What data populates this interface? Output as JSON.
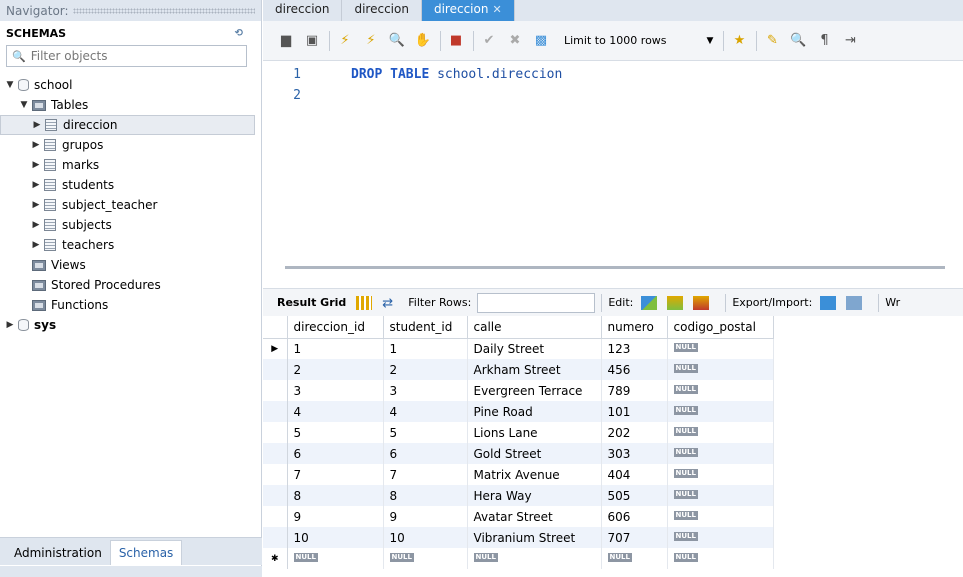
{
  "navigator": {
    "title": "Navigator:",
    "schemas_label": "SCHEMAS",
    "filter_placeholder": "Filter objects",
    "tree": {
      "school": "school",
      "tables": "Tables",
      "table_items": [
        "direccion",
        "grupos",
        "marks",
        "students",
        "subject_teacher",
        "subjects",
        "teachers"
      ],
      "views": "Views",
      "procedures": "Stored Procedures",
      "functions": "Functions",
      "sys": "sys"
    },
    "tabs": {
      "administration": "Administration",
      "schemas": "Schemas"
    }
  },
  "editor": {
    "tabs": [
      "direccion",
      "direccion",
      "direccion"
    ],
    "limit_label": "Limit to 1000 rows",
    "lines": [
      {
        "num": "1",
        "keyword": "DROP TABLE",
        "text": " school.direccion"
      },
      {
        "num": "2",
        "keyword": "",
        "text": ""
      }
    ]
  },
  "result": {
    "grid_label": "Result Grid",
    "filter_rows": "Filter Rows:",
    "edit": "Edit:",
    "export": "Export/Import:",
    "wrap": "Wr",
    "columns": [
      "direccion_id",
      "student_id",
      "calle",
      "numero",
      "codigo_postal"
    ],
    "rows": [
      [
        "1",
        "1",
        "Daily Street",
        "123",
        "NULL"
      ],
      [
        "2",
        "2",
        "Arkham Street",
        "456",
        "NULL"
      ],
      [
        "3",
        "3",
        "Evergreen Terrace",
        "789",
        "NULL"
      ],
      [
        "4",
        "4",
        "Pine Road",
        "101",
        "NULL"
      ],
      [
        "5",
        "5",
        "Lions Lane",
        "202",
        "NULL"
      ],
      [
        "6",
        "6",
        "Gold Street",
        "303",
        "NULL"
      ],
      [
        "7",
        "7",
        "Matrix Avenue",
        "404",
        "NULL"
      ],
      [
        "8",
        "8",
        "Hera Way",
        "505",
        "NULL"
      ],
      [
        "9",
        "9",
        "Avatar Street",
        "606",
        "NULL"
      ],
      [
        "10",
        "10",
        "Vibranium Street",
        "707",
        "NULL"
      ]
    ],
    "new_row": [
      "NULL",
      "NULL",
      "NULL",
      "NULL",
      "NULL"
    ]
  }
}
